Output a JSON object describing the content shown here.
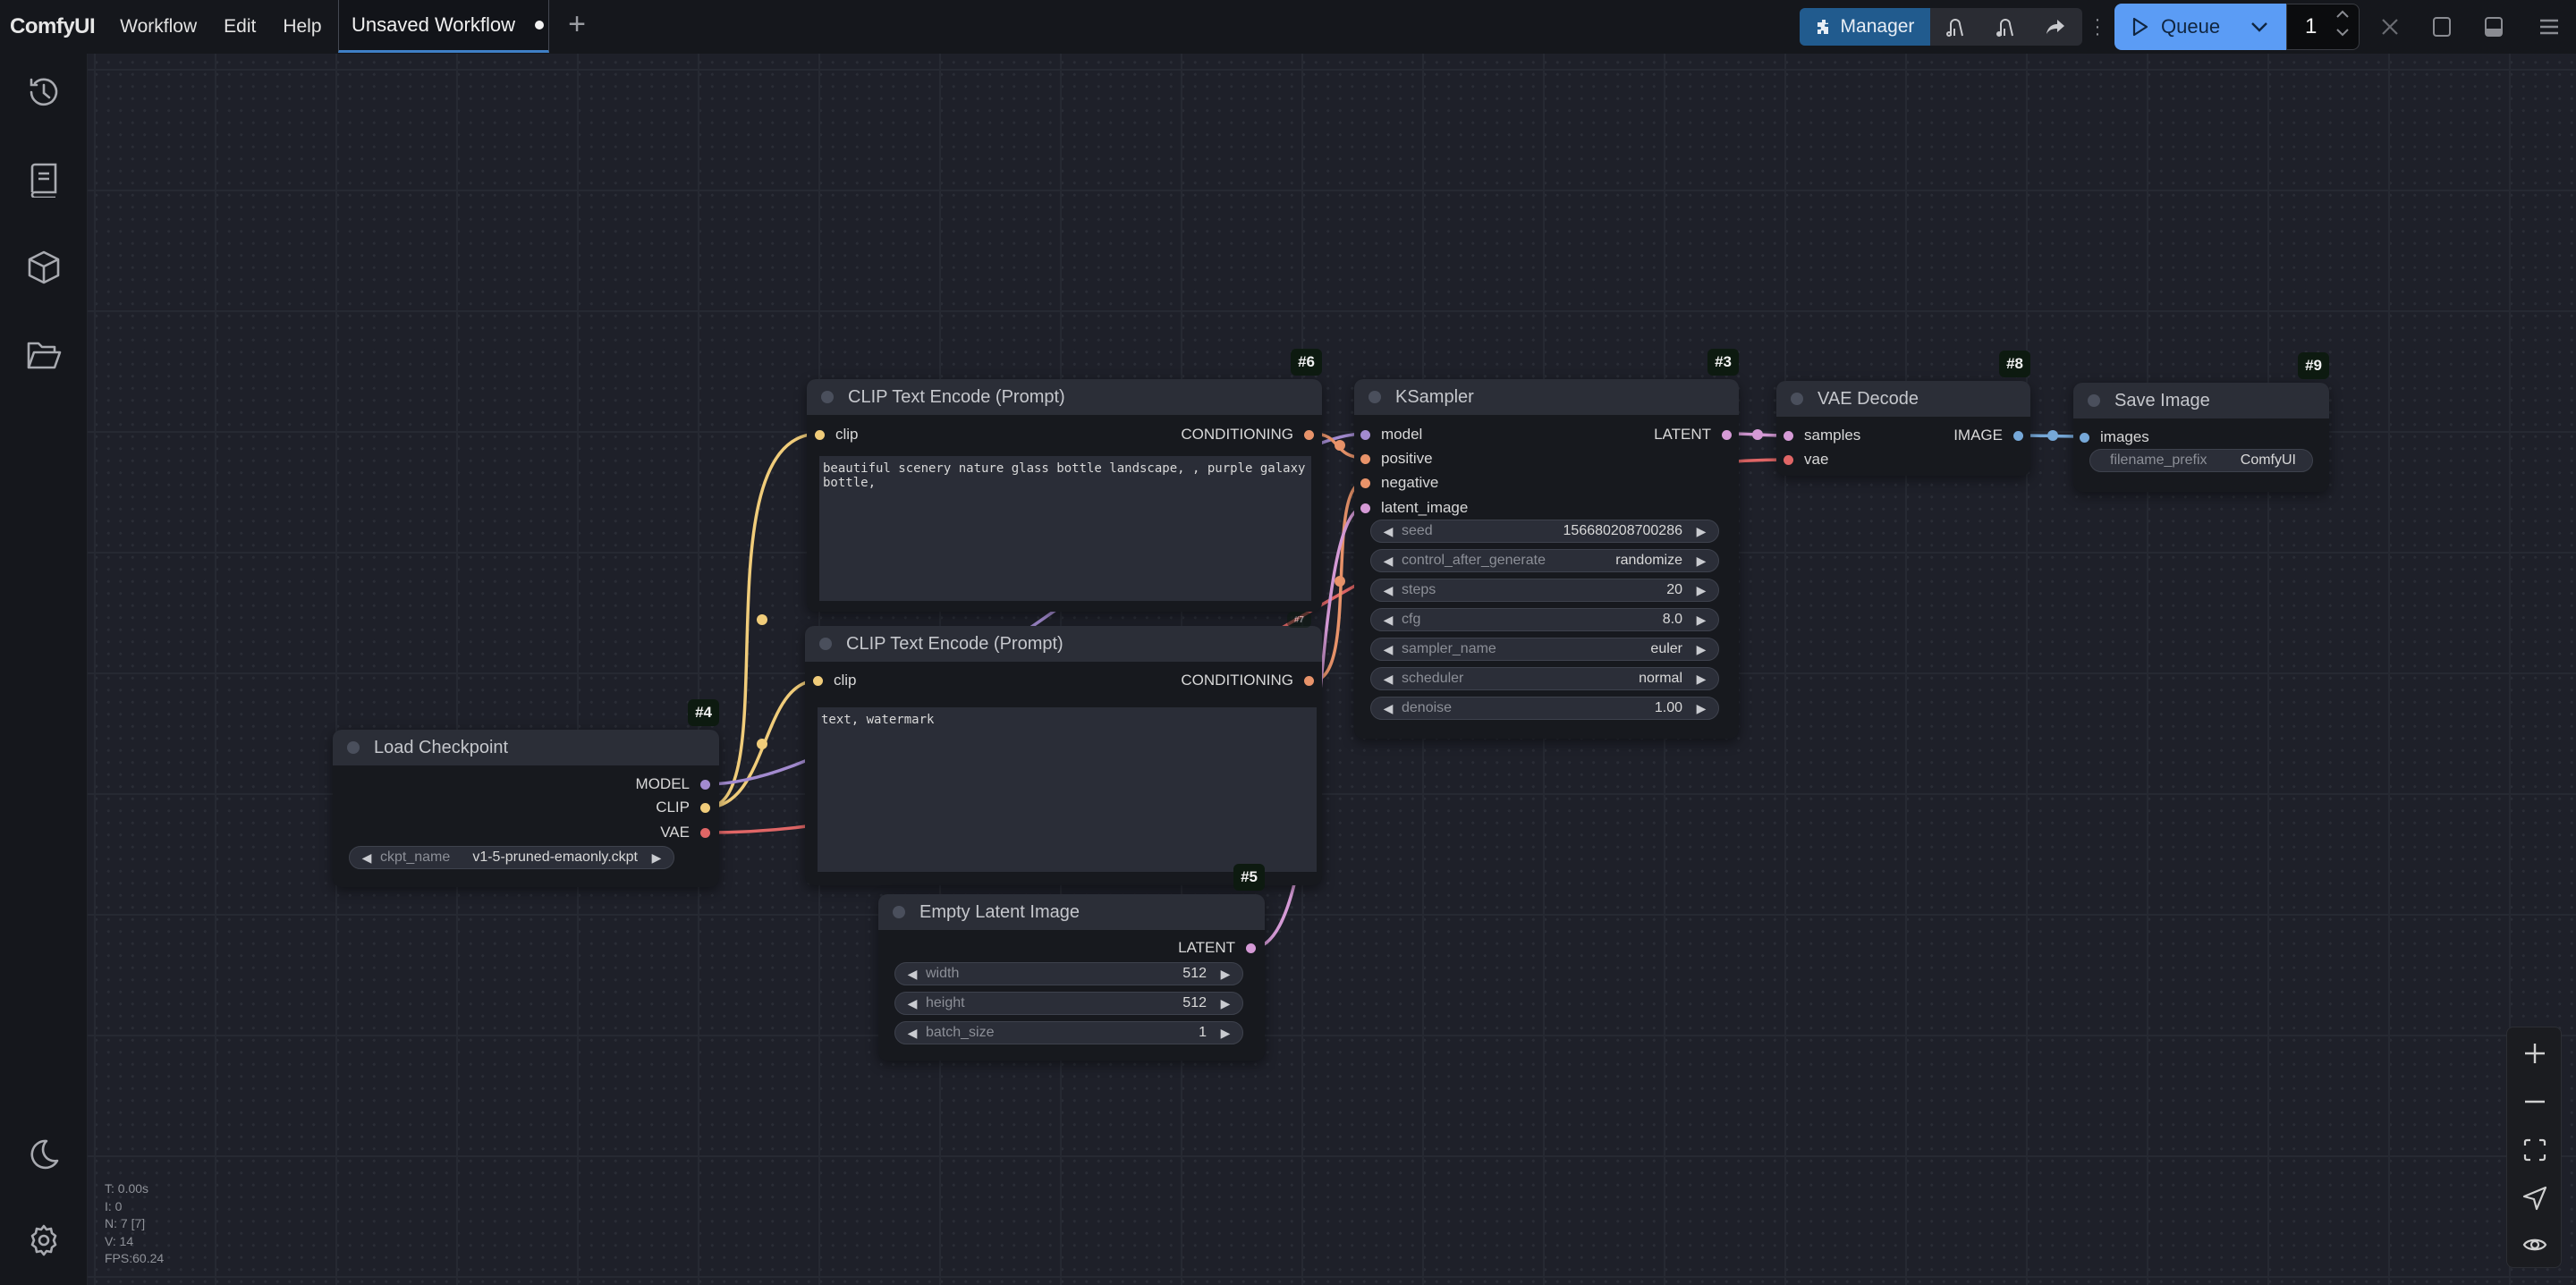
{
  "app": {
    "brand": "ComfyUI",
    "menu": [
      "Workflow",
      "Edit",
      "Help"
    ],
    "tab": {
      "label": "Unsaved Workflow",
      "modified": true
    }
  },
  "toolbar": {
    "manager_label": "Manager",
    "icons": [
      "unload-models-icon",
      "free-memory-icon",
      "share-icon"
    ],
    "queue_label": "Queue",
    "queue_count": "1",
    "right_icons": [
      "close-icon",
      "toggle-sidebar-icon",
      "toggle-bottom-panel-icon",
      "hamburger-menu-icon"
    ]
  },
  "sidebar": {
    "top_icons": [
      "history-icon",
      "library-icon",
      "model-cube-icon",
      "folder-open-icon"
    ],
    "bottom_icons": [
      "theme-moon-icon",
      "settings-gear-icon"
    ]
  },
  "nodes": {
    "clip_pos": {
      "id": "#6",
      "title": "CLIP Text Encode (Prompt)",
      "input": "clip",
      "output": "CONDITIONING",
      "text": "beautiful scenery nature glass bottle landscape, , purple galaxy\nbottle,"
    },
    "clip_neg": {
      "id": "#7",
      "title": "CLIP Text Encode (Prompt)",
      "input": "clip",
      "output": "CONDITIONING",
      "text": "text, watermark"
    },
    "ksampler": {
      "id": "#3",
      "title": "KSampler",
      "inputs": [
        "model",
        "positive",
        "negative",
        "latent_image"
      ],
      "output": "LATENT",
      "widgets": [
        {
          "label": "seed",
          "value": "156680208700286"
        },
        {
          "label": "control_after_generate",
          "value": "randomize"
        },
        {
          "label": "steps",
          "value": "20"
        },
        {
          "label": "cfg",
          "value": "8.0"
        },
        {
          "label": "sampler_name",
          "value": "euler"
        },
        {
          "label": "scheduler",
          "value": "normal"
        },
        {
          "label": "denoise",
          "value": "1.00"
        }
      ]
    },
    "vae_decode": {
      "id": "#8",
      "title": "VAE Decode",
      "inputs": [
        "samples",
        "vae"
      ],
      "output": "IMAGE"
    },
    "save_image": {
      "id": "#9",
      "title": "Save Image",
      "input": "images",
      "widget": {
        "label": "filename_prefix",
        "value": "ComfyUI"
      }
    },
    "load_checkpoint": {
      "id": "#4",
      "title": "Load Checkpoint",
      "outputs": [
        "MODEL",
        "CLIP",
        "VAE"
      ],
      "widget": {
        "label": "ckpt_name",
        "value": "v1-5-pruned-emaonly.ckpt"
      }
    },
    "empty_latent": {
      "id": "#5",
      "title": "Empty Latent Image",
      "output": "LATENT",
      "widgets": [
        {
          "label": "width",
          "value": "512"
        },
        {
          "label": "height",
          "value": "512"
        },
        {
          "label": "batch_size",
          "value": "1"
        }
      ]
    }
  },
  "colors": {
    "clip": "#f0cc7a",
    "conditioning": "#e8936a",
    "model": "#a38bd0",
    "vae": "#e06666",
    "latent": "#d59ad6",
    "image": "#76a8d8",
    "accent": "#5b9cf5",
    "manager": "#215b8e"
  },
  "stats": {
    "t": "T: 0.00s",
    "i": "I: 0",
    "n": "N: 7 [7]",
    "v": "V: 14",
    "fps": "FPS:60.24"
  },
  "zoom_controls": [
    "zoom-in-icon",
    "zoom-out-icon",
    "fit-view-icon",
    "select-mode-icon",
    "toggle-links-icon"
  ]
}
